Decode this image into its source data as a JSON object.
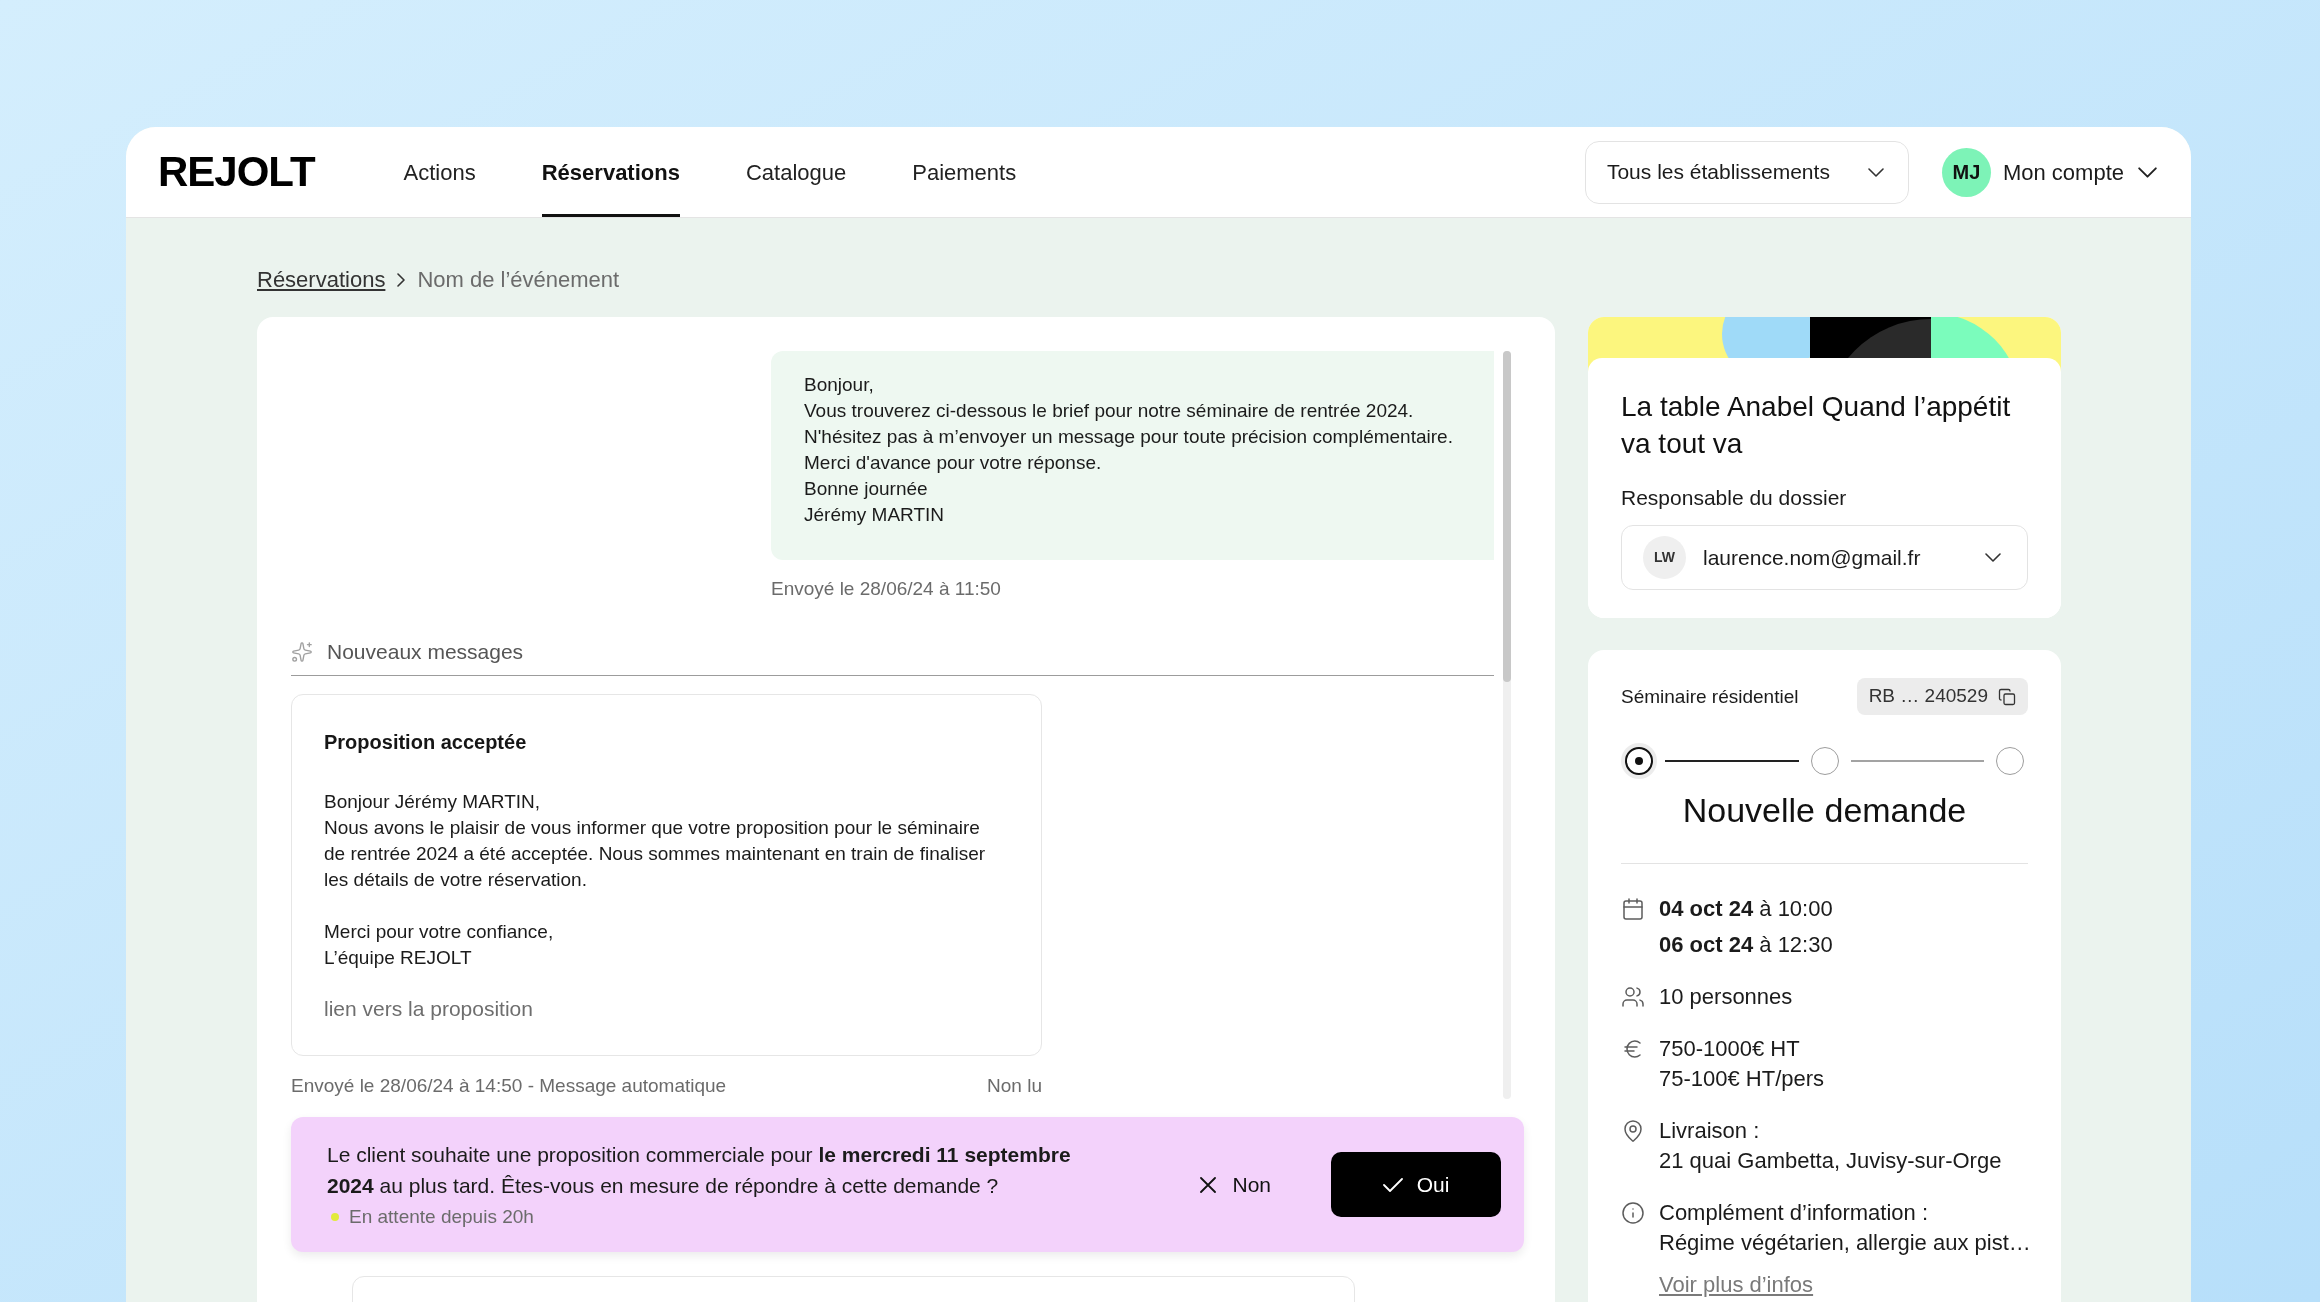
{
  "header": {
    "logo": "REJOLT",
    "nav": [
      {
        "label": "Actions",
        "selected": false
      },
      {
        "label": "Réservations",
        "selected": true
      },
      {
        "label": "Catalogue",
        "selected": false
      },
      {
        "label": "Paiements",
        "selected": false
      }
    ],
    "establishment_select": {
      "value": "Tous les établissements"
    },
    "account": {
      "initials": "MJ",
      "label": "Mon compte"
    }
  },
  "breadcrumb": [
    {
      "label": "Réservations",
      "kind": "link"
    },
    {
      "label": "Nom de l’événement",
      "kind": "current"
    }
  ],
  "conversation": {
    "items": [
      {
        "kind": "bubble",
        "text": "Bonjour,\nVous trouverez ci-dessous le brief pour notre séminaire de rentrée 2024.\nN'hésitez pas à m’envoyer un message pour toute précision complémentaire.\nMerci d'avance pour votre réponse.\nBonne journée\nJérémy MARTIN",
        "meta": "Envoyé le 28/06/24 à 11:50"
      },
      {
        "kind": "divider",
        "label": "Nouveaux messages"
      },
      {
        "kind": "card",
        "title": "Proposition acceptée",
        "paragraphs": [
          "Bonjour Jérémy MARTIN,\nNous avons le plaisir de vous informer que votre proposition pour le séminaire de rentrée 2024 a été acceptée. Nous sommes maintenant en train de finaliser les détails de votre réservation.",
          "Merci pour votre confiance,\nL’équipe REJOLT"
        ],
        "link": "lien vers la proposition",
        "meta": "Envoyé le 28/06/24 à 14:50 - Message automatique",
        "status": "Non lu"
      }
    ]
  },
  "request_banner": {
    "text": "Le client souhaite une proposition commerciale pour **le mercredi 11 septembre 2024** au plus tard. Êtes-vous en mesure de répondre à cette demande ?",
    "status": "En attente depuis 20h",
    "buttons": [
      {
        "label": "Non",
        "kind": "secondary"
      },
      {
        "label": "Oui",
        "kind": "primary"
      }
    ]
  },
  "venue_card": {
    "title": "La table Anabel Quand l’appétit va tout va",
    "manager_label": "Responsable du dossier",
    "manager": {
      "initials": "LW",
      "email": "laurence.nom@gmail.fr"
    }
  },
  "status_card": {
    "type": "Séminaire résidentiel",
    "reference": "RB … 240529",
    "steps": [
      {
        "selected": true
      },
      {
        "selected": false
      },
      {
        "selected": false
      }
    ],
    "status": "Nouvelle demande",
    "details": [
      {
        "kind": "dates",
        "lines": [
          "**04 oct 24** à 10:00",
          "**06 oct 24** à 12:30"
        ]
      },
      {
        "kind": "people",
        "lines": [
          "10 personnes"
        ]
      },
      {
        "kind": "price",
        "lines": [
          "750-1000€ HT",
          "75-100€ HT/pers"
        ]
      },
      {
        "kind": "location",
        "lines": [
          "Livraison :",
          "21 quai Gambetta, Juvisy-sur-Orge"
        ]
      },
      {
        "kind": "info",
        "lines": [
          "Complément d’information :",
          "Régime végétarien, allergie aux pist…"
        ],
        "link": "Voir plus d’infos"
      }
    ]
  }
}
